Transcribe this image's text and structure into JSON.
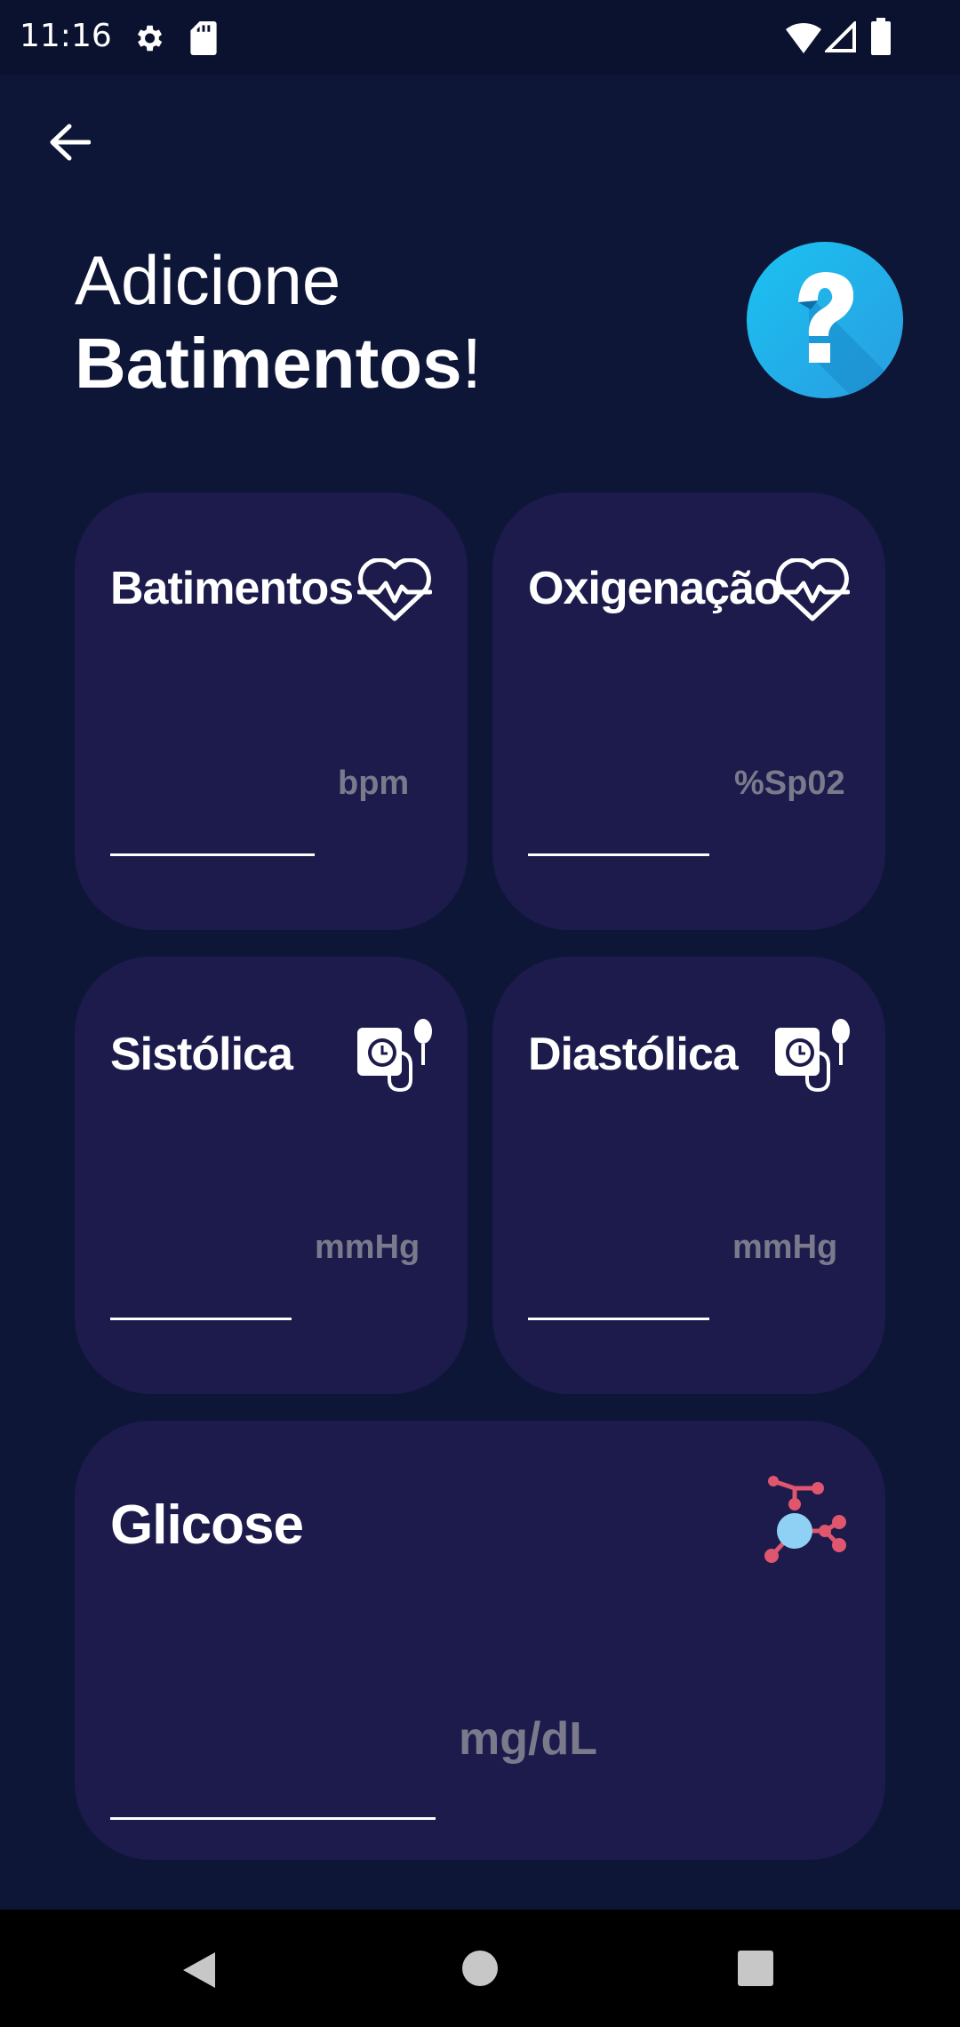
{
  "status_bar": {
    "time": "11:16",
    "icons": [
      "gear-icon",
      "sd-card-icon",
      "wifi-icon",
      "cell-signal-icon",
      "battery-icon"
    ]
  },
  "header": {
    "line1": "Adicione",
    "line2_bold": "Batimentos",
    "line2_suffix": "!",
    "help_icon": "question-mark-icon"
  },
  "cards": {
    "heart_rate": {
      "title": "Batimentos",
      "unit": "bpm",
      "value": "",
      "icon": "heartbeat-icon"
    },
    "oxygen": {
      "title": "Oxigenação",
      "unit": "%Sp02",
      "value": "",
      "icon": "heartbeat-icon"
    },
    "systolic": {
      "title": "Sistólica",
      "unit": "mmHg",
      "value": "",
      "icon": "blood-pressure-monitor-icon"
    },
    "diastolic": {
      "title": "Diastólica",
      "unit": "mmHg",
      "value": "",
      "icon": "blood-pressure-monitor-icon"
    },
    "glucose": {
      "title": "Glicose",
      "unit": "mg/dL",
      "value": "",
      "icon": "molecule-icon"
    }
  },
  "colors": {
    "background": "#0e1638",
    "card": "#1c1b4c",
    "unit_text": "#7a7a8c",
    "help_button": "#1fb4ea"
  }
}
